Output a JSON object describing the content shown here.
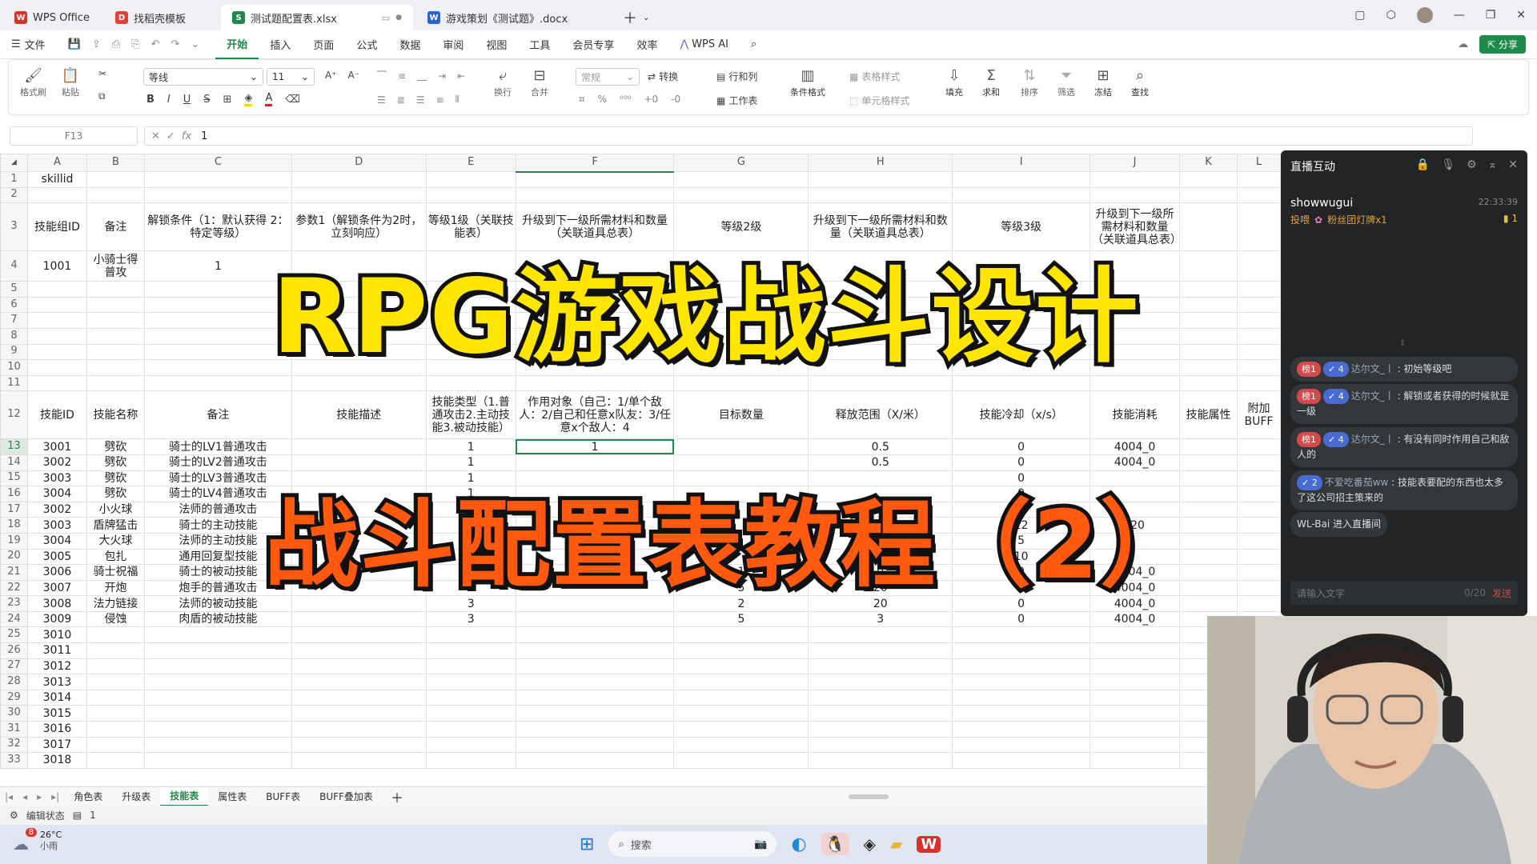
{
  "tabs": [
    {
      "label": "WPS Office",
      "icon": "wps-logo-icon",
      "color": "#d9312b"
    },
    {
      "label": "找稻壳模板",
      "icon": "docer-icon",
      "color": "#e0413b"
    },
    {
      "label": "测试题配置表.xlsx",
      "icon": "sheet-icon",
      "color": "#1d8a4a"
    },
    {
      "label": "游戏策划《测试题》.docx",
      "icon": "doc-icon",
      "color": "#2a62d6"
    }
  ],
  "menu": {
    "file": "文件",
    "items": [
      "开始",
      "插入",
      "页面",
      "公式",
      "数据",
      "审阅",
      "视图",
      "工具",
      "会员专享",
      "效率"
    ],
    "wps_ai": "WPS AI",
    "share": "分享"
  },
  "ribbon": {
    "format_painter": "格式刷",
    "paste": "粘贴",
    "font_name": "等线",
    "font_size": "11",
    "wrap": "换行",
    "merge": "合并",
    "number_format": "常规",
    "convert": "转换",
    "row_col": "行和列",
    "worksheet": "工作表",
    "cond_format": "条件格式",
    "table_style": "表格样式",
    "cell_style": "单元格样式",
    "fill": "填充",
    "sum": "求和",
    "sort": "排序",
    "filter": "筛选",
    "freeze": "冻结",
    "find": "查找"
  },
  "formula": {
    "cell_ref": "F13",
    "value": "1"
  },
  "sheet": {
    "col_headers": [
      "A",
      "B",
      "C",
      "D",
      "E",
      "F",
      "G",
      "H",
      "I",
      "J",
      "K",
      "L"
    ],
    "rows": [
      {
        "n": "1",
        "cells": [
          "skillid",
          "",
          "",
          "",
          "",
          "",
          "",
          "",
          "",
          "",
          "",
          ""
        ]
      },
      {
        "n": "2",
        "cells": [
          "",
          "",
          "",
          "",
          "",
          "",
          "",
          "",
          "",
          "",
          "",
          ""
        ]
      },
      {
        "n": "3",
        "cells": [
          "技能组ID",
          "备注",
          "解锁条件（1：默认获得 2：特定等级）",
          "参数1（解锁条件为2时，立刻响应）",
          "等级1级（关联技能表）",
          "升级到下一级所需材料和数量（关联道具总表）",
          "等级2级",
          "升级到下一级所需材料和数量（关联道具总表）",
          "等级3级",
          "升级到下一级所需材料和数量（关联道具总表）",
          "",
          ""
        ]
      },
      {
        "n": "4",
        "cells": [
          "1001",
          "小骑士得普攻",
          "1",
          "",
          "",
          "",
          "",
          "",
          "",
          "",
          "",
          ""
        ]
      },
      {
        "n": "5",
        "cells": [
          "",
          "",
          "",
          "",
          "",
          "",
          "",
          "",
          "",
          "",
          "",
          ""
        ]
      },
      {
        "n": "6",
        "cells": [
          "",
          "",
          "",
          "",
          "",
          "",
          "",
          "",
          "",
          "",
          "",
          ""
        ]
      },
      {
        "n": "7",
        "cells": [
          "",
          "",
          "",
          "",
          "",
          "",
          "",
          "",
          "",
          "",
          "",
          ""
        ]
      },
      {
        "n": "8",
        "cells": [
          "",
          "",
          "",
          "",
          "",
          "",
          "",
          "",
          "",
          "",
          "",
          ""
        ]
      },
      {
        "n": "9",
        "cells": [
          "",
          "",
          "",
          "",
          "",
          "",
          "",
          "",
          "",
          "",
          "",
          ""
        ]
      },
      {
        "n": "10",
        "cells": [
          "",
          "",
          "",
          "",
          "",
          "",
          "",
          "",
          "",
          "",
          "",
          ""
        ]
      },
      {
        "n": "11",
        "cells": [
          "",
          "",
          "",
          "",
          "",
          "",
          "",
          "",
          "",
          "",
          "",
          ""
        ]
      },
      {
        "n": "12",
        "cells": [
          "技能ID",
          "技能名称",
          "备注",
          "技能描述",
          "技能类型（1.普通攻击2.主动技能3.被动技能）",
          "作用对象（自己：1/单个敌人：2/自己和任意x队友：3/任意x个敌人：4",
          "目标数量",
          "释放范围（X/米）",
          "技能冷却（x/s）",
          "技能消耗",
          "技能属性",
          "附加BUFF"
        ]
      },
      {
        "n": "13",
        "cells": [
          "3001",
          "劈砍",
          "骑士的LV1普通攻击",
          "",
          "1",
          "1",
          "",
          "0.5",
          "0",
          "4004_0",
          "",
          ""
        ]
      },
      {
        "n": "14",
        "cells": [
          "3002",
          "劈砍",
          "骑士的LV2普通攻击",
          "",
          "1",
          "",
          "",
          "0.5",
          "0",
          "4004_0",
          "",
          ""
        ]
      },
      {
        "n": "15",
        "cells": [
          "3003",
          "劈砍",
          "骑士的LV3普通攻击",
          "",
          "1",
          "",
          "",
          "",
          "0",
          "",
          "",
          ""
        ]
      },
      {
        "n": "16",
        "cells": [
          "3004",
          "劈砍",
          "骑士的LV4普通攻击",
          "",
          "1",
          "",
          "",
          "",
          "0",
          "",
          "",
          ""
        ]
      },
      {
        "n": "17",
        "cells": [
          "3002",
          "小火球",
          "法师的普通攻击",
          "",
          "1",
          "",
          "",
          "",
          "0",
          "",
          "",
          ""
        ]
      },
      {
        "n": "18",
        "cells": [
          "3003",
          "盾牌猛击",
          "骑士的主动技能",
          "",
          "2",
          "",
          "",
          "",
          "12",
          "_20",
          "",
          ""
        ]
      },
      {
        "n": "19",
        "cells": [
          "3004",
          "大火球",
          "法师的主动技能",
          "",
          "2",
          "",
          "",
          "",
          "5",
          "",
          "",
          ""
        ]
      },
      {
        "n": "20",
        "cells": [
          "3005",
          "包扎",
          "通用回复型技能",
          "",
          "2",
          "",
          "",
          "",
          "10",
          "",
          "",
          ""
        ]
      },
      {
        "n": "21",
        "cells": [
          "3006",
          "骑士祝福",
          "骑士的被动技能",
          "",
          "3",
          "",
          "1",
          "0",
          "0",
          "4004_0",
          "",
          ""
        ]
      },
      {
        "n": "22",
        "cells": [
          "3007",
          "开炮",
          "炮手的普通攻击",
          "",
          "1",
          "",
          "5",
          "20",
          "2",
          "4004_0",
          "",
          ""
        ]
      },
      {
        "n": "23",
        "cells": [
          "3008",
          "法力链接",
          "法师的被动技能",
          "",
          "3",
          "",
          "2",
          "20",
          "0",
          "4004_0",
          "",
          ""
        ]
      },
      {
        "n": "24",
        "cells": [
          "3009",
          "侵蚀",
          "肉盾的被动技能",
          "",
          "3",
          "",
          "5",
          "3",
          "0",
          "4004_0",
          "",
          ""
        ]
      },
      {
        "n": "25",
        "cells": [
          "3010",
          "",
          "",
          "",
          "",
          "",
          "",
          "",
          "",
          "",
          "",
          ""
        ]
      },
      {
        "n": "26",
        "cells": [
          "3011",
          "",
          "",
          "",
          "",
          "",
          "",
          "",
          "",
          "",
          "",
          ""
        ]
      },
      {
        "n": "27",
        "cells": [
          "3012",
          "",
          "",
          "",
          "",
          "",
          "",
          "",
          "",
          "",
          "",
          ""
        ]
      },
      {
        "n": "28",
        "cells": [
          "3013",
          "",
          "",
          "",
          "",
          "",
          "",
          "",
          "",
          "",
          "",
          ""
        ]
      },
      {
        "n": "29",
        "cells": [
          "3014",
          "",
          "",
          "",
          "",
          "",
          "",
          "",
          "",
          "",
          "",
          ""
        ]
      },
      {
        "n": "30",
        "cells": [
          "3015",
          "",
          "",
          "",
          "",
          "",
          "",
          "",
          "",
          "",
          "",
          ""
        ]
      },
      {
        "n": "31",
        "cells": [
          "3016",
          "",
          "",
          "",
          "",
          "",
          "",
          "",
          "",
          "",
          "",
          ""
        ]
      },
      {
        "n": "32",
        "cells": [
          "3017",
          "",
          "",
          "",
          "",
          "",
          "",
          "",
          "",
          "",
          "",
          ""
        ]
      },
      {
        "n": "33",
        "cells": [
          "3018",
          "",
          "",
          "",
          "",
          "",
          "",
          "",
          "",
          "",
          "",
          ""
        ]
      }
    ]
  },
  "overlay": {
    "title1": "RPG游戏战斗设计",
    "title2": "战斗配置表教程（2）"
  },
  "sheet_tabs": [
    "角色表",
    "升级表",
    "技能表",
    "属性表",
    "BUFF表",
    "BUFF叠加表"
  ],
  "active_sheet": "技能表",
  "status": {
    "mode": "编辑状态",
    "value": "1"
  },
  "taskbar": {
    "weather_temp": "26°C",
    "weather_desc": "小雨",
    "weather_badge": "8",
    "search": "搜索"
  },
  "chat": {
    "title": "直播互动",
    "top_user": "showwugui",
    "top_time": "22:33:39",
    "top_action": "投喂",
    "top_gift": "粉丝团灯牌x1",
    "top_count": "1",
    "messages": [
      {
        "rank": "榜1",
        "level": "4",
        "user": "达尔文_丨",
        "text": "初始等级吧"
      },
      {
        "rank": "榜1",
        "level": "4",
        "user": "达尔文_丨",
        "text": "解锁或者获得的时候就是一级"
      },
      {
        "rank": "榜1",
        "level": "4",
        "user": "达尔文_丨",
        "text": "有没有同时作用自己和敌人的"
      },
      {
        "rank": "",
        "level": "2",
        "user": "不爱吃番茄ww",
        "text": "技能表要配的东西也太多了这公司招主策来的"
      }
    ],
    "enter_notice": "WL-Bai 进入直播间",
    "input_placeholder": "请输入文字",
    "counter": "0/20",
    "send": "发送"
  }
}
